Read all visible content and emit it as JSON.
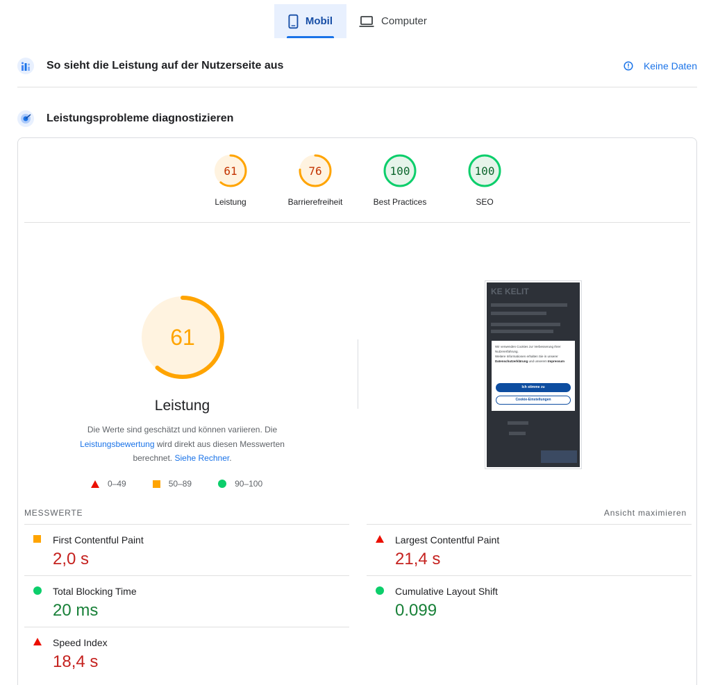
{
  "tabs": [
    {
      "label": "Mobil",
      "active": true
    },
    {
      "label": "Computer",
      "active": false
    }
  ],
  "field_section": {
    "title": "So sieht die Leistung auf der Nutzerseite aus",
    "status": "Keine Daten"
  },
  "lab_section": {
    "title": "Leistungsprobleme diagnostizieren"
  },
  "categories": [
    {
      "label": "Leistung",
      "score": "61",
      "level": "average"
    },
    {
      "label": "Barrierefreiheit",
      "score": "76",
      "level": "average"
    },
    {
      "label": "Best Practices",
      "score": "100",
      "level": "pass"
    },
    {
      "label": "SEO",
      "score": "100",
      "level": "pass"
    }
  ],
  "performance": {
    "score": "61",
    "score_value": 61,
    "title": "Leistung",
    "desc_1": "Die Werte sind geschätzt und können variieren. Die",
    "desc_link_1": "Leistungsbewertung",
    "desc_2": " wird direkt aus diesen Messwerten berechnet. ",
    "desc_link_2": "Siehe Rechner",
    "desc_3": "."
  },
  "legend": [
    {
      "shape": "triangle",
      "color": "#eb0f00",
      "label": "0–49"
    },
    {
      "shape": "square",
      "color": "#ffa400",
      "label": "50–89"
    },
    {
      "shape": "circle",
      "color": "#0cce6b",
      "label": "90–100"
    }
  ],
  "screenshot": {
    "logo": "KE KELIT",
    "cookie_text_1": "Wir verwenden Cookies zur Verbesserung Ihrer Nutzererfahrung.",
    "cookie_text_2": "Weitere Informationen erhalten Sie in unserer",
    "cookie_link_1": "Datenschutzerklärung",
    "cookie_text_3": " und unserem ",
    "cookie_link_2": "Impressum",
    "accept_button": "Ich stimme zu",
    "settings_button": "Cookie-Einstellungen"
  },
  "metrics_header": {
    "title": "Messwerte",
    "expand_link": "Ansicht maximieren"
  },
  "metrics": [
    {
      "name": "First Contentful Paint",
      "value": "2,0 s",
      "rating": "average"
    },
    {
      "name": "Largest Contentful Paint",
      "value": "21,4 s",
      "rating": "fail"
    },
    {
      "name": "Total Blocking Time",
      "value": "20 ms",
      "rating": "pass"
    },
    {
      "name": "Cumulative Layout Shift",
      "value": "0.099",
      "rating": "pass"
    },
    {
      "name": "Speed Index",
      "value": "18,4 s",
      "rating": "fail"
    }
  ],
  "colors": {
    "fail": "#eb0f00",
    "average": "#ffa400",
    "pass": "#0cce6b",
    "accent": "#1a73e8"
  }
}
